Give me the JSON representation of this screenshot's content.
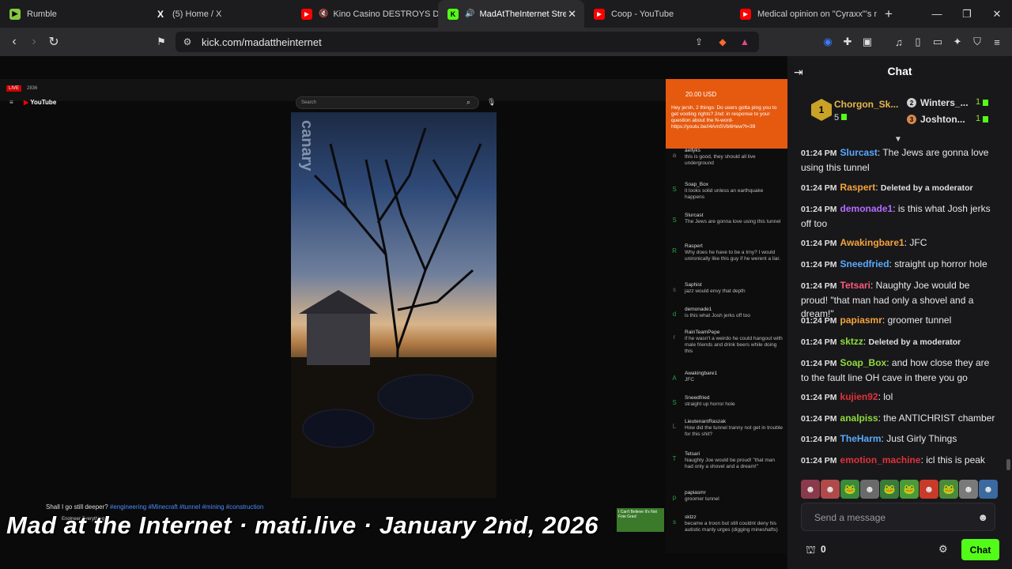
{
  "tabs": [
    {
      "title": "Rumble",
      "favicon_color": "#85c742",
      "favicon_glyph": "▶"
    },
    {
      "title": "(5) Home / X",
      "favicon_color": "#ffffff",
      "favicon_glyph": "X"
    },
    {
      "title": "Kino Casino DESTROYS DSP",
      "favicon_color": "#ff0000",
      "favicon_glyph": "▶",
      "muted": true
    },
    {
      "title": "MadAtTheInternet Stream",
      "favicon_color": "#53fc18",
      "favicon_glyph": "K",
      "active": true
    },
    {
      "title": "Coop - YouTube",
      "favicon_color": "#ff0000",
      "favicon_glyph": "▶"
    },
    {
      "title": "Medical opinion on \"Cyraxx\"'s m",
      "favicon_color": "#ff0000",
      "favicon_glyph": "▶"
    }
  ],
  "address": {
    "url": "kick.com/madattheinternet"
  },
  "video": {
    "yt_live": "LIVE",
    "yt_viewers": "2836",
    "yt_logo": "YouTube",
    "yt_search_placeholder": "Search",
    "canary_text": "canary",
    "description": "Shall I go still deeper?",
    "hashtags": "#engineering #Minecraft #tunnel #mining #construction",
    "channel": "Engineer Everything",
    "ad_text": "I Can't Believe It's Not Foie Gras!",
    "watermark": "Mad at the Internet · mati.live · January 2nd, 2026",
    "superchat_amount": "20.00 USD",
    "superchat_message": "Hey jersh, 2 things: Do users gotta ping you to get vooting rights? 2nd: in response to your question about the N-word- https://youtu.be/i4AmSVb6Hew?t=39",
    "yt_messages": [
      {
        "name": "aellyks",
        "text": "this is good, they should all live underground",
        "avatar": "a",
        "color": "#777"
      },
      {
        "name": "Soap_Box",
        "text": "it looks solid unless an earthquake happens",
        "avatar": "S",
        "color": "#2d9e4a"
      },
      {
        "name": "Slurcast",
        "text": "The Jews are gonna love using this tunnel",
        "avatar": "S",
        "color": "#2d9e4a"
      },
      {
        "name": "Raspert",
        "text": "Why does he have to be a trny? I would unironically like this guy if he werent a liar.",
        "avatar": "R",
        "color": "#2d9e4a"
      },
      {
        "name": "Saphist",
        "text": "jazz would envy that depth",
        "avatar": "s",
        "color": "#666"
      },
      {
        "name": "demonade1",
        "text": "is this what Josh jerks off too",
        "avatar": "d",
        "color": "#2d9e4a"
      },
      {
        "name": "RainTeamPepe",
        "text": "if he wasn't a weirdo he could hangout with male friends and drink beers while doing this",
        "avatar": "r",
        "color": "#4a8a3a"
      },
      {
        "name": "Awakingbare1",
        "text": "JFC",
        "avatar": "A",
        "color": "#2d9e4a"
      },
      {
        "name": "Sneedfried",
        "text": "straight up horror hole",
        "avatar": "S",
        "color": "#2d9e4a"
      },
      {
        "name": "LieutenantRaszak",
        "text": "How did the tunnel tranny not get in trouble for this shit?",
        "avatar": "L",
        "color": "#666"
      },
      {
        "name": "Tetsari",
        "text": "Naughty Joe would be proud! \"that man had only a shovel and a dream!\"",
        "avatar": "T",
        "color": "#2d9e4a"
      },
      {
        "name": "papiasmr",
        "text": "groomer tunnel",
        "avatar": "p",
        "color": "#2d9e4a"
      },
      {
        "name": "sktzz",
        "text": "became a troon but still couldnt deny his autistic manly urges (digging mineshafts)",
        "avatar": "s",
        "color": "#2d9e4a"
      }
    ]
  },
  "chat": {
    "title": "Chat",
    "leaderboard": [
      {
        "rank": "1",
        "name": "Chorgon_Sk...",
        "count": "5"
      },
      {
        "rank": "2",
        "name": "Winters_...",
        "count": "1"
      },
      {
        "rank": "3",
        "name": "Joshton...",
        "count": "1"
      }
    ],
    "messages": [
      {
        "time": "01:24 PM",
        "user": "Slurcast",
        "color": "#5aa9ff",
        "text": "The Jews are gonna love using this tunnel",
        "deleted": false
      },
      {
        "time": "01:24 PM",
        "user": "Raspert",
        "color": "#f6a33a",
        "text": "Deleted by a moderator",
        "deleted": true
      },
      {
        "time": "01:24 PM",
        "user": "demonade1",
        "color": "#b36cff",
        "text": "is this what Josh jerks off too",
        "deleted": false
      },
      {
        "time": "01:24 PM",
        "user": "Awakingbare1",
        "color": "#f6a33a",
        "text": "JFC",
        "deleted": false
      },
      {
        "time": "01:24 PM",
        "user": "Sneedfried",
        "color": "#5aa9ff",
        "text": "straight up horror hole",
        "deleted": false
      },
      {
        "time": "01:24 PM",
        "user": "Tetsari",
        "color": "#ff5a7a",
        "text": "Naughty Joe would be proud! \"that man had only a shovel and a dream!\"",
        "deleted": false
      },
      {
        "time": "01:24 PM",
        "user": "papiasmr",
        "color": "#f6a33a",
        "text": "groomer tunnel",
        "deleted": false
      },
      {
        "time": "01:24 PM",
        "user": "sktzz",
        "color": "#8fdc3b",
        "text": "Deleted by a moderator",
        "deleted": true
      },
      {
        "time": "01:24 PM",
        "user": "Soap_Box",
        "color": "#8fdc3b",
        "text": "and how close they are to the fault line OH cave in there you go",
        "deleted": false
      },
      {
        "time": "01:24 PM",
        "user": "kujien92",
        "color": "#e0323a",
        "text": "lol",
        "deleted": false
      },
      {
        "time": "01:24 PM",
        "user": "analpiss",
        "color": "#8fdc3b",
        "text": "the ANTICHRIST chamber",
        "deleted": false
      },
      {
        "time": "01:24 PM",
        "user": "TheHarm",
        "color": "#5aa9ff",
        "text": "Just Girly Things",
        "deleted": false
      },
      {
        "time": "01:24 PM",
        "user": "emotion_machine",
        "color": "#e0323a",
        "text": "icl this is peak",
        "deleted": false
      }
    ],
    "input_placeholder": "Send a message",
    "points": "0",
    "send_label": "Chat",
    "accent": "#53fc18"
  }
}
